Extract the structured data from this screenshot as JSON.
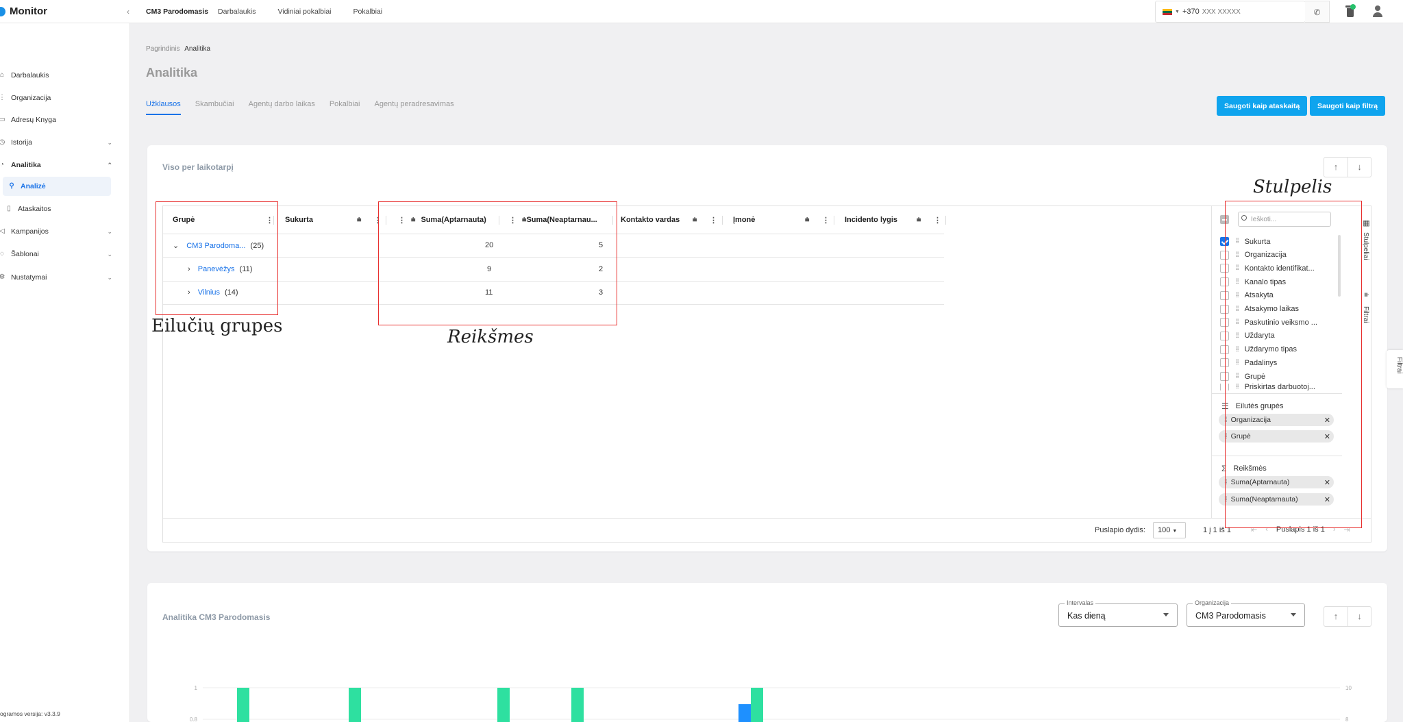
{
  "app": {
    "name": "Monitor"
  },
  "topnav": [
    "CM3 Parodomasis",
    "Darbalaukis",
    "Vidiniai pokalbiai",
    "Pokalbiai"
  ],
  "phone": {
    "code": "+370",
    "placeholder": "XXX XXXXX"
  },
  "sidebar": {
    "items": [
      {
        "label": "Darbalaukis",
        "icon": "home-icon"
      },
      {
        "label": "Organizacija",
        "icon": "org-icon"
      },
      {
        "label": "Adresų Knyga",
        "icon": "book-icon"
      },
      {
        "label": "Istorija",
        "icon": "history-icon",
        "expandable": true
      },
      {
        "label": "Analitika",
        "icon": "analytics-icon",
        "expanded": true
      },
      {
        "label": "Analizė",
        "icon": "search-icon",
        "active": true
      },
      {
        "label": "Ataskaitos",
        "icon": "document-icon"
      },
      {
        "label": "Kampanijos",
        "icon": "campaign-icon",
        "expandable": true
      },
      {
        "label": "Šablonai",
        "icon": "template-icon",
        "expandable": true
      },
      {
        "label": "Nustatymai",
        "icon": "gear-icon",
        "expandable": true
      }
    ],
    "version": "ogramos versija: v3.3.9"
  },
  "breadcrumb": {
    "root": "Pagrindinis",
    "current": "Analitika"
  },
  "page_title": "Analitika",
  "tabs": [
    "Užklausos",
    "Skambučiai",
    "Agentų darbo laikas",
    "Pokalbiai",
    "Agentų peradresavimas"
  ],
  "actions": {
    "save_report": "Saugoti kaip ataskaitą",
    "save_filter": "Saugoti kaip filtrą"
  },
  "card1": {
    "title": "Viso per laikotarpį",
    "columns": [
      "Grupė",
      "Sukurta",
      "Suma(Aptarnauta)",
      "Suma(Neaptarnau...",
      "Kontakto vardas",
      "Įmonė",
      "Incidento lygis"
    ],
    "rows": [
      {
        "label": "CM3 Parodoma...",
        "count": "(25)",
        "aptarnauta": "20",
        "neaptarnauta": "5"
      },
      {
        "label": "Panevėžys",
        "count": "(11)",
        "aptarnauta": "9",
        "neaptarnauta": "2"
      },
      {
        "label": "Vilnius",
        "count": "(14)",
        "aptarnauta": "11",
        "neaptarnauta": "3"
      }
    ],
    "footer": {
      "page_size_label": "Puslapio dydis:",
      "page_size": "100",
      "range": "1 į 1 iš 1",
      "page": "Puslapis 1 iš 1"
    }
  },
  "tool_panel": {
    "search_placeholder": "Ieškoti...",
    "columns": [
      {
        "label": "Sukurta",
        "checked": true
      },
      {
        "label": "Organizacija",
        "checked": false
      },
      {
        "label": "Kontakto identifikat...",
        "checked": false
      },
      {
        "label": "Kanalo tipas",
        "checked": false
      },
      {
        "label": "Atsakyta",
        "checked": false
      },
      {
        "label": "Atsakymo laikas",
        "checked": false
      },
      {
        "label": "Paskutinio veiksmo ...",
        "checked": false
      },
      {
        "label": "Uždaryta",
        "checked": false
      },
      {
        "label": "Uždarymo tipas",
        "checked": false
      },
      {
        "label": "Padalinys",
        "checked": false
      },
      {
        "label": "Grupė",
        "checked": false
      },
      {
        "label": "Priskirtas darbuotoj...",
        "checked": false
      }
    ],
    "row_groups_label": "Eilutės grupės",
    "row_groups": [
      "Organizacija",
      "Grupė"
    ],
    "values_label": "Reikšmės",
    "values": [
      "Suma(Aptarnauta)",
      "Suma(Neaptarnauta)"
    ],
    "vtabs": [
      "Stulpeliai",
      "Filtrai"
    ]
  },
  "edge_tab": "Filtrai",
  "annotations": {
    "row_groups": "Eilučių grupes",
    "values": "Reikšmes",
    "column": "Stulpelis",
    "color": "#e8302f"
  },
  "card2": {
    "title": "Analitika CM3 Parodomasis",
    "interval_label": "Intervalas",
    "interval_value": "Kas dieną",
    "org_label": "Organizacija",
    "org_value": "CM3 Parodomasis"
  },
  "chart_data": {
    "type": "bar",
    "left_ticks": [
      "1",
      "0.8"
    ],
    "right_ticks": [
      "10",
      "8"
    ],
    "colors": {
      "primary": "#2ee0a0",
      "secondary": "#1e90ff"
    },
    "bars": [
      {
        "x": 346,
        "series": "primary"
      },
      {
        "x": 509,
        "series": "primary"
      },
      {
        "x": 726,
        "series": "primary"
      },
      {
        "x": 834,
        "series": "primary"
      },
      {
        "x": 1078,
        "series": "secondary",
        "partial": true
      },
      {
        "x": 1096,
        "series": "primary"
      }
    ]
  }
}
